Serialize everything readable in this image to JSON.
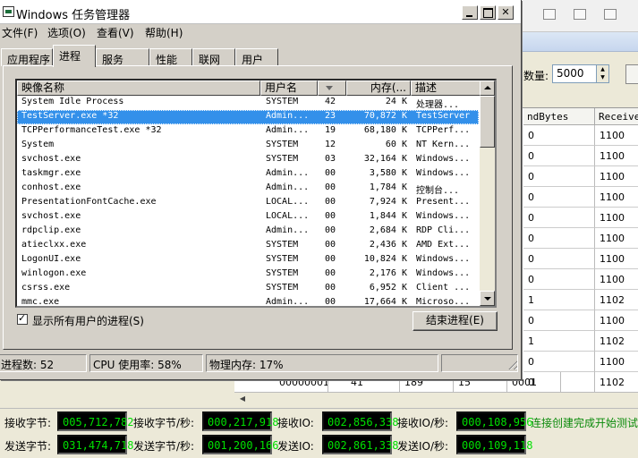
{
  "background": {
    "count_label": "数量:",
    "count_value": "5000",
    "columns": [
      "ndBytes",
      "Receive"
    ],
    "rows": [
      [
        "0",
        "1100"
      ],
      [
        "0",
        "1100"
      ],
      [
        "0",
        "1100"
      ],
      [
        "0",
        "1100"
      ],
      [
        "0",
        "1100"
      ],
      [
        "0",
        "1100"
      ],
      [
        "0",
        "1100"
      ],
      [
        "0",
        "1100"
      ],
      [
        "1",
        "1102"
      ],
      [
        "0",
        "1100"
      ],
      [
        "1",
        "1102"
      ],
      [
        "0",
        "1100"
      ],
      [
        "0",
        "1102"
      ]
    ],
    "partial_row": [
      "000000013",
      "41",
      "189",
      "15",
      "0001"
    ],
    "stats": {
      "row1": [
        {
          "label": "接收字节:",
          "value": "005,712,782"
        },
        {
          "label": "接收字节/秒:",
          "value": "000,217,918"
        },
        {
          "label": "接收IO:",
          "value": "002,856,338"
        },
        {
          "label": "接收IO/秒:",
          "value": "000,108,956"
        }
      ],
      "row2": [
        {
          "label": "发送字节:",
          "value": "031,474,718"
        },
        {
          "label": "发送字节/秒:",
          "value": "001,200,166"
        },
        {
          "label": "发送IO:",
          "value": "002,861,338"
        },
        {
          "label": "发送IO/秒:",
          "value": "000,109,118"
        }
      ],
      "message": "连接创建完成开始测试"
    }
  },
  "window": {
    "title": "Windows 任务管理器",
    "close_label": "✕",
    "menu": [
      "文件(F)",
      "选项(O)",
      "查看(V)",
      "帮助(H)"
    ],
    "tabs": [
      "应用程序",
      "进程",
      "服务",
      "性能",
      "联网",
      "用户"
    ],
    "active_tab": "进程",
    "columns": {
      "name": "映像名称",
      "user": "用户名",
      "cpu": "",
      "mem": "内存(...",
      "desc": "描述"
    },
    "processes": [
      {
        "name": "System Idle Process",
        "user": "SYSTEM",
        "cpu": "42",
        "mem": "24 K",
        "desc": "处理器...",
        "selected": false
      },
      {
        "name": "TestServer.exe *32",
        "user": "Admin...",
        "cpu": "23",
        "mem": "70,872 K",
        "desc": "TestServer",
        "selected": true
      },
      {
        "name": "TCPPerformanceTest.exe *32",
        "user": "Admin...",
        "cpu": "19",
        "mem": "68,180 K",
        "desc": "TCPPerf...",
        "selected": false
      },
      {
        "name": "System",
        "user": "SYSTEM",
        "cpu": "12",
        "mem": "60 K",
        "desc": "NT Kern...",
        "selected": false
      },
      {
        "name": "svchost.exe",
        "user": "SYSTEM",
        "cpu": "03",
        "mem": "32,164 K",
        "desc": "Windows...",
        "selected": false
      },
      {
        "name": "taskmgr.exe",
        "user": "Admin...",
        "cpu": "00",
        "mem": "3,580 K",
        "desc": "Windows...",
        "selected": false
      },
      {
        "name": "conhost.exe",
        "user": "Admin...",
        "cpu": "00",
        "mem": "1,784 K",
        "desc": "控制台...",
        "selected": false
      },
      {
        "name": "PresentationFontCache.exe",
        "user": "LOCAL...",
        "cpu": "00",
        "mem": "7,924 K",
        "desc": "Present...",
        "selected": false
      },
      {
        "name": "svchost.exe",
        "user": "LOCAL...",
        "cpu": "00",
        "mem": "1,844 K",
        "desc": "Windows...",
        "selected": false
      },
      {
        "name": "rdpclip.exe",
        "user": "Admin...",
        "cpu": "00",
        "mem": "2,684 K",
        "desc": "RDP Cli...",
        "selected": false
      },
      {
        "name": "atieclxx.exe",
        "user": "SYSTEM",
        "cpu": "00",
        "mem": "2,436 K",
        "desc": "AMD Ext...",
        "selected": false
      },
      {
        "name": "LogonUI.exe",
        "user": "SYSTEM",
        "cpu": "00",
        "mem": "10,824 K",
        "desc": "Windows...",
        "selected": false
      },
      {
        "name": "winlogon.exe",
        "user": "SYSTEM",
        "cpu": "00",
        "mem": "2,176 K",
        "desc": "Windows...",
        "selected": false
      },
      {
        "name": "csrss.exe",
        "user": "SYSTEM",
        "cpu": "00",
        "mem": "6,952 K",
        "desc": "Client ...",
        "selected": false
      },
      {
        "name": "mmc.exe",
        "user": "Admin...",
        "cpu": "00",
        "mem": "17,664 K",
        "desc": "Microso...",
        "selected": false
      }
    ],
    "show_all_label": "显示所有用户的进程(S)",
    "show_all_checked": true,
    "end_process_label": "结束进程(E)",
    "status": {
      "processes": "进程数: 52",
      "cpu": "CPU 使用率: 58%",
      "memory": "物理内存: 17%"
    }
  }
}
